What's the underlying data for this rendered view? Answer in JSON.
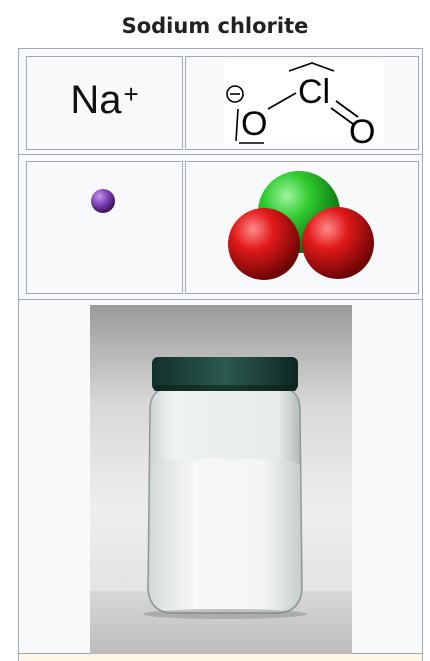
{
  "title": "Sodium chlorite",
  "cation_formula": "Na",
  "cation_charge": "+",
  "anion_structure": {
    "atom_left": "O",
    "atom_center": "Cl",
    "atom_right": "O",
    "charge_symbol": "−"
  },
  "colors": {
    "sodium": "#7b3fa8",
    "chlorine": "#33c433",
    "oxygen": "#e41b1b",
    "jar_lid": "#1f4a40"
  }
}
